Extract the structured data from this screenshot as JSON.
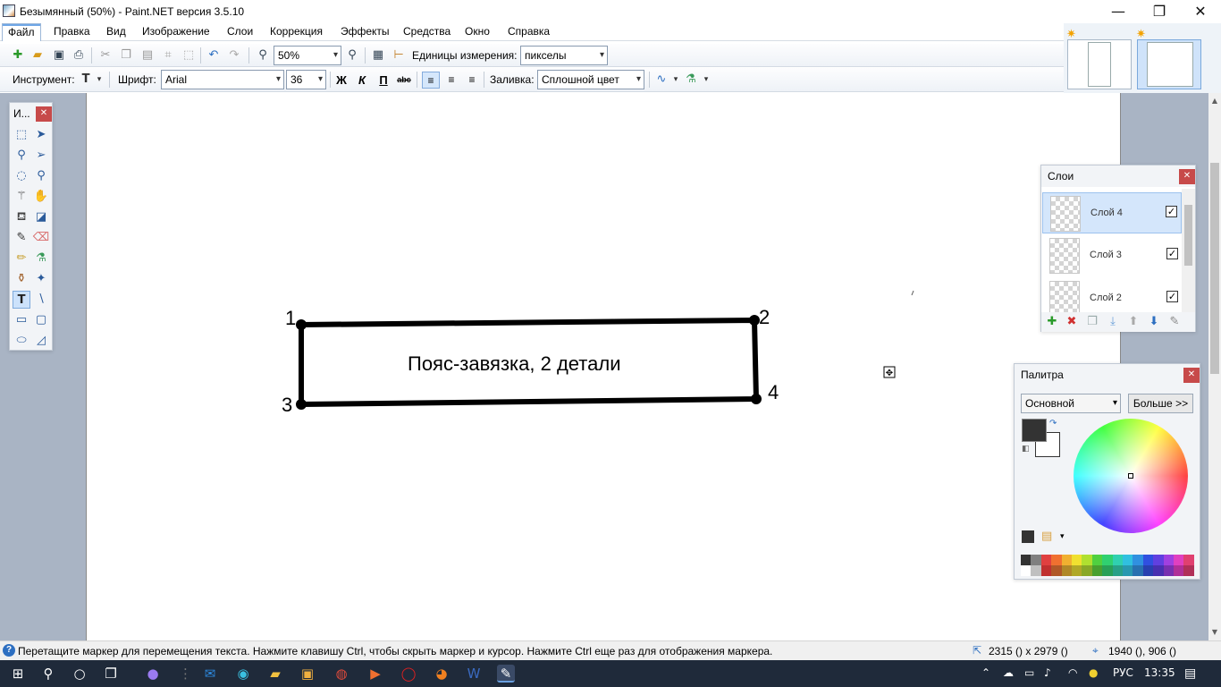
{
  "window": {
    "title": "Безымянный (50%) - Paint.NET версия 3.5.10",
    "minimize": "—",
    "restore": "❐",
    "close": "✕"
  },
  "menu": [
    "Файл",
    "Правка",
    "Вид",
    "Изображение",
    "Слои",
    "Коррекция",
    "Эффекты",
    "Средства",
    "Окно",
    "Справка"
  ],
  "toolbar1": {
    "zoom_value": "50%",
    "units_label": "Единицы измерения:",
    "units_value": "пикселы"
  },
  "toolbar2": {
    "tool_label": "Инструмент:",
    "font_label": "Шрифт:",
    "font_value": "Arial",
    "size_value": "36",
    "bold": "Ж",
    "italic": "К",
    "underline": "П",
    "strike": "abc",
    "fill_label": "Заливка:",
    "fill_value": "Сплошной цвет"
  },
  "tools_panel": {
    "title": "И..."
  },
  "canvas": {
    "label_text": "Пояс-завязка, 2 детали",
    "corner_1": "1",
    "corner_2": "2",
    "corner_3": "3",
    "corner_4": "4"
  },
  "layers_panel": {
    "title": "Слои",
    "layers": [
      {
        "name": "Слой 4",
        "visible": true,
        "selected": true
      },
      {
        "name": "Слой 3",
        "visible": true,
        "selected": false
      },
      {
        "name": "Слой 2",
        "visible": true,
        "selected": false
      }
    ]
  },
  "palette_panel": {
    "title": "Палитра",
    "mode": "Основной",
    "more_button": "Больше >>",
    "primary_color": "#333333",
    "secondary_color": "#ffffff",
    "swatch_row1": [
      "#333333",
      "#808080",
      "#e04040",
      "#f07030",
      "#f0b030",
      "#f0e030",
      "#b0e030",
      "#50d040",
      "#30d070",
      "#30d0b0",
      "#30c0e0",
      "#3090e0",
      "#3050e0",
      "#6040e0",
      "#a040e0",
      "#e040c0",
      "#e04070"
    ],
    "swatch_row2": [
      "#ffffff",
      "#c0c0c0",
      "#c03030",
      "#b05828",
      "#b08828",
      "#b0a828",
      "#88a828",
      "#48a030",
      "#28a058",
      "#28a088",
      "#2898b0",
      "#2870b0",
      "#2840b0",
      "#4830b0",
      "#7830b0",
      "#b03098",
      "#b03058"
    ]
  },
  "status": {
    "message": "Перетащите маркер для перемещения текста. Нажмите клавишу Ctrl, чтобы скрыть маркер и курсор. Нажмите Ctrl еще раз для отображения маркера.",
    "image_size": "2315 () x 2979 ()",
    "cursor_pos": "1940 (), 906 ()"
  },
  "taskbar": {
    "language": "РУС",
    "time": "13:35"
  }
}
